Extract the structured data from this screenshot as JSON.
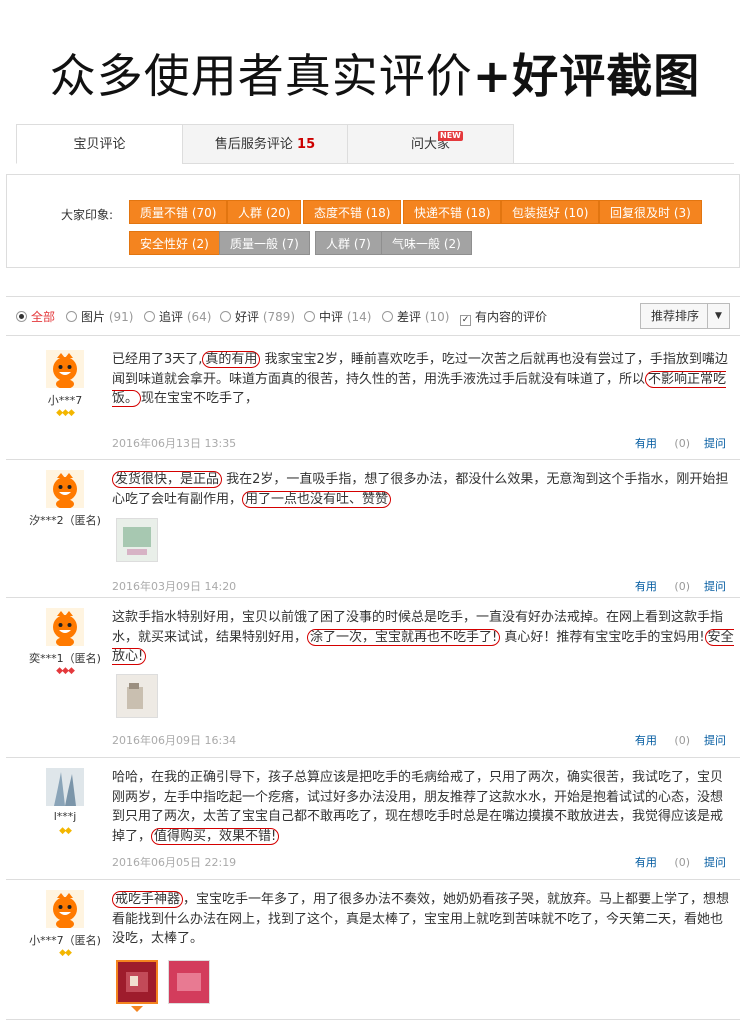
{
  "banner": {
    "text": "众多使用者真实评价",
    "bold": "+好评截图"
  },
  "tabs": [
    {
      "label": "宝贝评论",
      "count": ""
    },
    {
      "label": "售后服务评论",
      "count": "15"
    },
    {
      "label": "问大家",
      "badge": "NEW"
    }
  ],
  "impressions": {
    "label": "大家印象:",
    "tags": [
      {
        "text": "质量不错 (70)",
        "style": "orange"
      },
      {
        "text": "人群 (20)",
        "style": "orange"
      },
      {
        "text": "态度不错 (18)",
        "style": "orange"
      },
      {
        "text": "快递不错 (18)",
        "style": "orange"
      },
      {
        "text": "包装挺好 (10)",
        "style": "orange"
      },
      {
        "text": "回复很及时 (3)",
        "style": "orange"
      },
      {
        "text": "安全性好 (2)",
        "style": "orange"
      },
      {
        "text": "质量一般 (7)",
        "style": "gray"
      },
      {
        "text": "人群 (7)",
        "style": "gray"
      },
      {
        "text": "气味一般 (2)",
        "style": "gray"
      }
    ]
  },
  "filter": {
    "options": [
      {
        "label": "全部",
        "count": ""
      },
      {
        "label": "图片",
        "count": "(91)"
      },
      {
        "label": "追评",
        "count": "(64)"
      },
      {
        "label": "好评",
        "count": "(789)"
      },
      {
        "label": "中评",
        "count": "(14)"
      },
      {
        "label": "差评",
        "count": "(10)"
      }
    ],
    "content_only": "有内容的评价",
    "sort_label": "推荐排序"
  },
  "reviews": [
    {
      "user": "小***7",
      "level": "gold",
      "parts": [
        {
          "t": "已经用了3天了,"
        },
        {
          "t": "真的有用",
          "hl": true
        },
        {
          "t": "   我家宝宝2岁，睡前喜欢吃手，吃过一次苦之后就再也没有尝过了，手指放到嘴边闻到味道就会拿开。味道方面真的很苦，持久性的苦，用洗手液洗过手后就没有味道了，所以"
        },
        {
          "t": "不影响正常吃饭。",
          "hl": true
        },
        {
          "t": "现在宝宝不吃手了，"
        }
      ],
      "date": "2016年06月13日 13:35",
      "useful": "有用",
      "useful_count": "(0)",
      "reply": "提问"
    },
    {
      "user": "汐***2（匿名)",
      "level": "",
      "parts": [
        {
          "t": "发货很快，是正品",
          "hl": true
        },
        {
          "t": "   我在2岁，一直吸手指，想了很多办法，都没什么效果，无意淘到这个手指水，刚开始担心吃了会吐有副作用，"
        },
        {
          "t": "用了一点也没有吐、赞赞",
          "hl": true
        }
      ],
      "date": "2016年03月09日 14:20",
      "useful": "有用",
      "useful_count": "(0)",
      "reply": "提问"
    },
    {
      "user": "奕***1（匿名)",
      "level": "red",
      "parts": [
        {
          "t": "这款手指水特别好用，宝贝以前饿了困了没事的时候总是吃手，一直没有好办法戒掉。在网上看到这款手指水，就买来试试，结果特别好用，"
        },
        {
          "t": "涂了一次，宝宝就再也不吃手了!",
          "hl": true
        },
        {
          "t": " 真心好！推荐有宝宝吃手的宝妈用!"
        },
        {
          "t": "安全放心!",
          "hl": true
        }
      ],
      "date": "2016年06月09日 16:34",
      "useful": "有用",
      "useful_count": "(0)",
      "reply": "提问"
    },
    {
      "user": "l***j",
      "level": "gold",
      "parts": [
        {
          "t": "哈哈，在我的正确引导下，孩子总算应该是把吃手的毛病给戒了，只用了两次，确实很苦，我试吃了，宝贝刚两岁，左手中指吃起一个疙瘩，试过好多办法没用，朋友推荐了这款水水，开始是抱着试试的心态，没想到只用了两次，太苦了宝宝自己都不敢再吃了，现在想吃手时总是在嘴边摸摸不敢放进去，我觉得应该是戒掉了，"
        },
        {
          "t": "值得购买，效果不错!",
          "hl": true
        }
      ],
      "date": "2016年06月05日 22:19",
      "useful": "有用",
      "useful_count": "(0)",
      "reply": "提问"
    },
    {
      "user": "小***7（匿名)",
      "level": "gold",
      "parts": [
        {
          "t": "戒吃手神器",
          "hl": true
        },
        {
          "t": "，宝宝吃手一年多了，用了很多办法不奏效，她奶奶看孩子哭，就放弃。马上都要上学了，想想看能找到什么办法在网上，找到了这个，真是太棒了，宝宝用上就吃到苦味就不吃了，今天第二天，看她也没吃，太棒了。"
        }
      ],
      "date": "",
      "useful": "",
      "useful_count": "",
      "reply": ""
    }
  ],
  "colors": {
    "accent": "#f4841f",
    "highlight": "#d40000",
    "link": "#005aa0",
    "alert": "#e4393c"
  }
}
